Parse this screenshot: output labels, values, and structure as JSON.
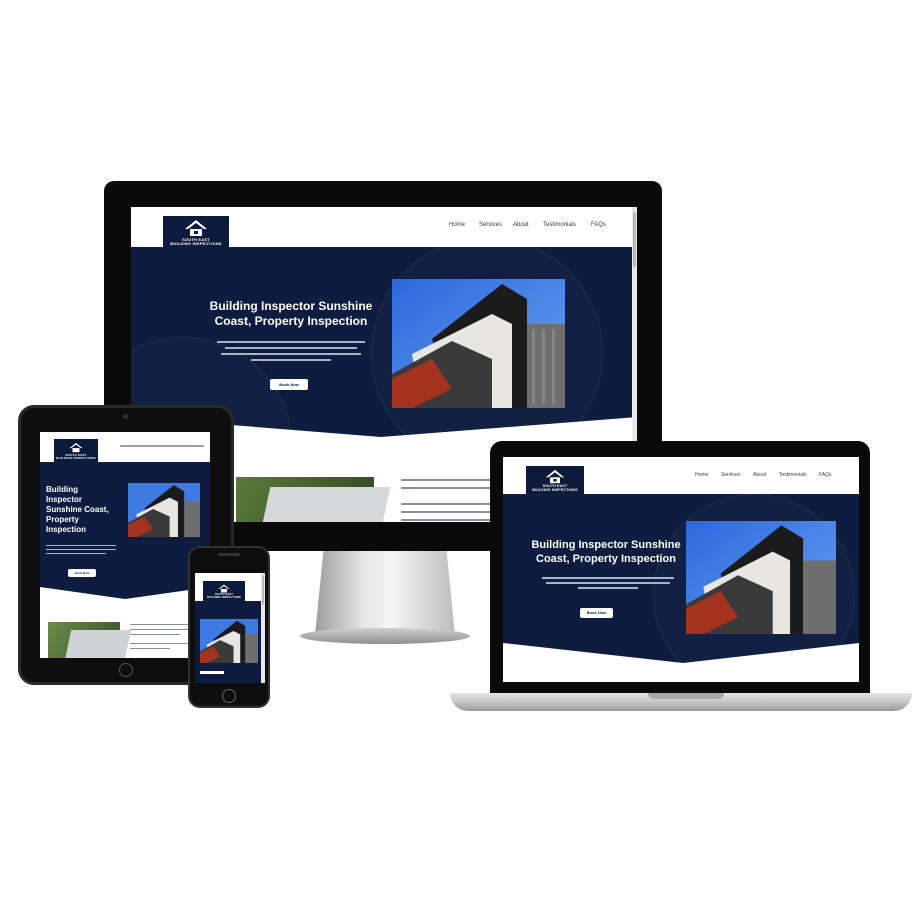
{
  "site": {
    "logo": {
      "line1": "SOUTH EAST",
      "line2": "BUILDING INSPECTIONS",
      "icon": "house-icon"
    },
    "nav": [
      "Home",
      "Services",
      "About",
      "Testimonials",
      "FAQs"
    ],
    "hero": {
      "title_desktop": "Building Inspector Sunshine Coast, Property Inspection",
      "title_tablet": "Building Inspector Sunshine Coast, Property Inspection",
      "button": "Book Now"
    },
    "colors": {
      "navy": "#0d1c3f",
      "logo_bg": "#0c1a3b",
      "white": "#ffffff"
    }
  },
  "devices": [
    "desktop-monitor",
    "laptop",
    "tablet",
    "phone"
  ]
}
